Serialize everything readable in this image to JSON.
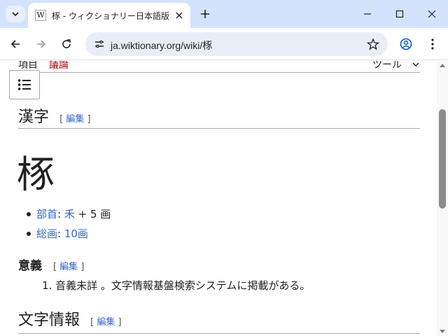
{
  "browser": {
    "tab_title": "㭬 - ウィクショナリー日本語版",
    "favicon_letter": "W",
    "url": "ja.wiktionary.org/wiki/㭬"
  },
  "nav": {
    "article": "項目",
    "talk": "議論",
    "tools": "ツール"
  },
  "section_kanji": {
    "title": "漢字",
    "edit_open": "[ ",
    "edit_label": "編集",
    "edit_close": " ]"
  },
  "character": "㭬",
  "info_list": [
    {
      "label": "部首",
      "sep": ": ",
      "value_link": "禾",
      "value_rest": " + 5 画"
    },
    {
      "label": "総画",
      "sep": ": ",
      "value_link": "10画",
      "value_rest": ""
    }
  ],
  "section_meaning": {
    "title": "意義",
    "edit_label": "編集",
    "items": [
      {
        "number": "1.",
        "text": "音義未詳 。文字情報基盤検索システムに掲載がある。"
      }
    ]
  },
  "section_charinfo": {
    "title": "文字情報",
    "edit_label": "編集"
  },
  "colors": {
    "link": "#3366cc",
    "talk_link": "#ba0000",
    "titlebar": "#d3e3fd",
    "omnibox": "#e9eef6"
  },
  "icons": [
    "tab-search-icon",
    "close-icon",
    "plus-icon",
    "minimize-icon",
    "maximize-icon",
    "back-icon",
    "forward-icon",
    "reload-icon",
    "site-info-icon",
    "star-icon",
    "profile-icon",
    "menu-dots-icon",
    "chevron-down-icon",
    "toc-list-icon"
  ]
}
